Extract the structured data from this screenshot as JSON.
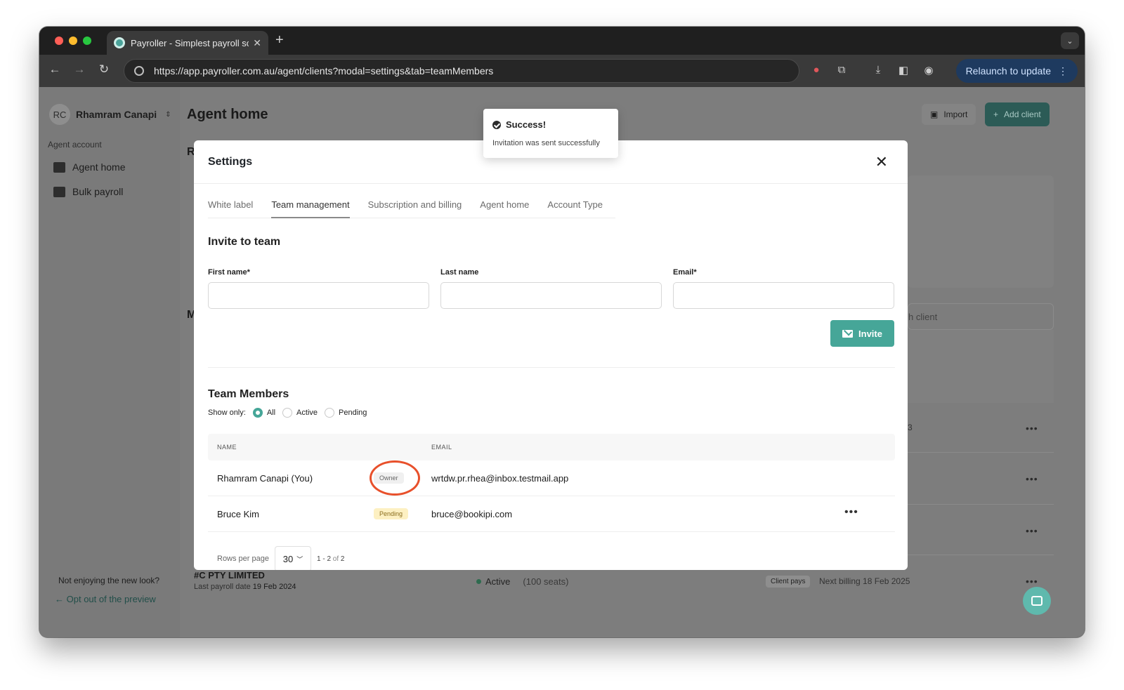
{
  "browser": {
    "tab_title": "Payroller - Simplest payroll sc",
    "url": "https://app.payroller.com.au/agent/clients?modal=settings&tab=teamMembers",
    "relaunch_label": "Relaunch to update"
  },
  "sidebar": {
    "avatar_initials": "RC",
    "account_name": "Rhamram Canapi",
    "section_label": "Agent account",
    "items": [
      {
        "label": "Agent home",
        "icon": "home-icon"
      },
      {
        "label": "Bulk payroll",
        "icon": "payroll-icon"
      }
    ],
    "footer_text": "Not enjoying the new look?",
    "opt_out_label": "Opt out of the preview"
  },
  "main": {
    "title": "Agent home",
    "import_label": "Import",
    "add_client_label": "Add client",
    "partial_r": "R",
    "partial_m": "M",
    "search_partial": "h client",
    "company_name": "#C PTY LIMITED",
    "last_payroll_prefix": "Last payroll date",
    "last_payroll_date": "19 Feb 2024",
    "status_label": "Active",
    "seats_label": "(100 seats)",
    "client_pays_label": "Client pays",
    "next_billing": "Next billing 18 Feb 2025",
    "partial_digit": "3"
  },
  "toast": {
    "title": "Success!",
    "message": "Invitation was sent successfully"
  },
  "modal": {
    "title": "Settings",
    "tabs": [
      "White label",
      "Team management",
      "Subscription and billing",
      "Agent home",
      "Account Type"
    ],
    "active_tab": "Team management",
    "invite_title": "Invite to team",
    "fields": {
      "first_name_label": "First name*",
      "last_name_label": "Last name",
      "email_label": "Email*",
      "first_name_value": "",
      "last_name_value": "",
      "email_value": ""
    },
    "invite_button": "Invite",
    "members_title": "Team Members",
    "show_only_label": "Show only:",
    "filters": [
      "All",
      "Active",
      "Pending"
    ],
    "selected_filter": "All",
    "table": {
      "headers": [
        "NAME",
        "EMAIL"
      ],
      "rows": [
        {
          "name": "Rhamram Canapi (You)",
          "badge": "Owner",
          "email": "wrtdw.pr.rhea@inbox.testmail.app"
        },
        {
          "name": "Bruce Kim",
          "badge": "Pending",
          "email": "bruce@bookipi.com"
        }
      ]
    },
    "rows_per_page_label": "Rows per page",
    "rows_per_page_value": "30",
    "range_start": "1",
    "range_end": "2",
    "range_of": "of",
    "range_total": "2"
  },
  "colors": {
    "accent": "#46a698",
    "annotation_ring": "#e8502b",
    "pending_badge": "#fdf0c2"
  }
}
